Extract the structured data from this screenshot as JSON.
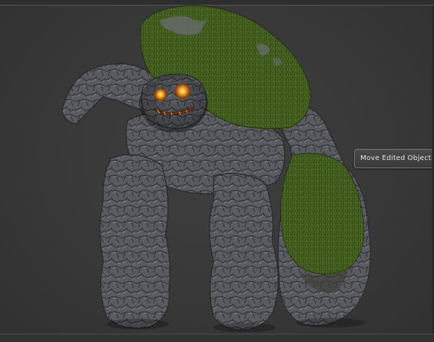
{
  "viewport": {
    "tooltip": {
      "label": "Move Edited Object"
    },
    "model": {
      "stone_color": "#5c5d62",
      "moss_color": "#3f5a1e",
      "eye_color": "#f0a020"
    }
  }
}
